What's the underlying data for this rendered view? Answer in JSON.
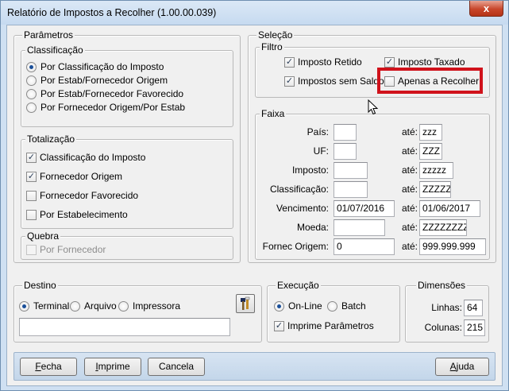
{
  "window": {
    "title": "Relatório de Impostos a Recolher (1.00.00.039)",
    "close_glyph": "x"
  },
  "parametros": {
    "legend": "Parâmetros",
    "classificacao": {
      "legend": "Classificação",
      "options": [
        "Por Classificação do Imposto",
        "Por Estab/Fornecedor Origem",
        "Por Estab/Fornecedor Favorecido",
        "Por Fornecedor Origem/Por Estab"
      ],
      "selected": 0
    },
    "totalizacao": {
      "legend": "Totalização",
      "items": [
        {
          "label": "Classificação do Imposto",
          "checked": true
        },
        {
          "label": "Fornecedor Origem",
          "checked": true
        },
        {
          "label": "Fornecedor Favorecido",
          "checked": false
        },
        {
          "label": "Por Estabelecimento",
          "checked": false
        }
      ]
    },
    "quebra": {
      "legend": "Quebra",
      "item": {
        "label": "Por Fornecedor",
        "checked": false,
        "disabled": true
      }
    }
  },
  "selecao": {
    "legend": "Seleção",
    "filtro": {
      "legend": "Filtro",
      "items": [
        {
          "label": "Imposto Retido",
          "checked": true
        },
        {
          "label": "Imposto Taxado",
          "checked": true
        },
        {
          "label": "Impostos sem Saldo",
          "checked": true
        },
        {
          "label": "Apenas a Recolher",
          "checked": false
        }
      ]
    },
    "faixa": {
      "legend": "Faixa",
      "ate_label": "até:",
      "rows": [
        {
          "label": "País:",
          "from": "",
          "to": "zzz"
        },
        {
          "label": "UF:",
          "from": "",
          "to": "ZZZ"
        },
        {
          "label": "Imposto:",
          "from": "",
          "to": "zzzzz"
        },
        {
          "label": "Classificação:",
          "from": "",
          "to": "ZZZZZ"
        },
        {
          "label": "Vencimento:",
          "from": "01/07/2016",
          "to": "01/06/2017"
        },
        {
          "label": "Moeda:",
          "from": "",
          "to": "ZZZZZZZZ"
        },
        {
          "label": "Fornec Origem:",
          "from": "0",
          "to": "999.999.999"
        }
      ]
    }
  },
  "destino": {
    "legend": "Destino",
    "options": [
      "Terminal",
      "Arquivo",
      "Impressora"
    ],
    "selected": 0,
    "path_value": ""
  },
  "execucao": {
    "legend": "Execução",
    "options": [
      "On-Line",
      "Batch"
    ],
    "selected": 0,
    "imprime": {
      "label": "Imprime Parâmetros",
      "checked": true
    }
  },
  "dimensoes": {
    "legend": "Dimensões",
    "linhas_label": "Linhas:",
    "linhas": "64",
    "colunas_label": "Colunas:",
    "colunas": "215"
  },
  "buttons": {
    "fecha": {
      "first": "F",
      "rest": "echa"
    },
    "imprime": {
      "first": "I",
      "rest": "mprime"
    },
    "cancela": "Cancela",
    "ajuda": {
      "first": "A",
      "rest": "juda"
    }
  },
  "colors": {
    "highlight": "#d0121b",
    "window_frame": "#cfe0f2",
    "bottom_bar": "#c3d6ea"
  },
  "icons": [
    "close-icon",
    "tools-icon",
    "mouse-cursor-icon"
  ]
}
